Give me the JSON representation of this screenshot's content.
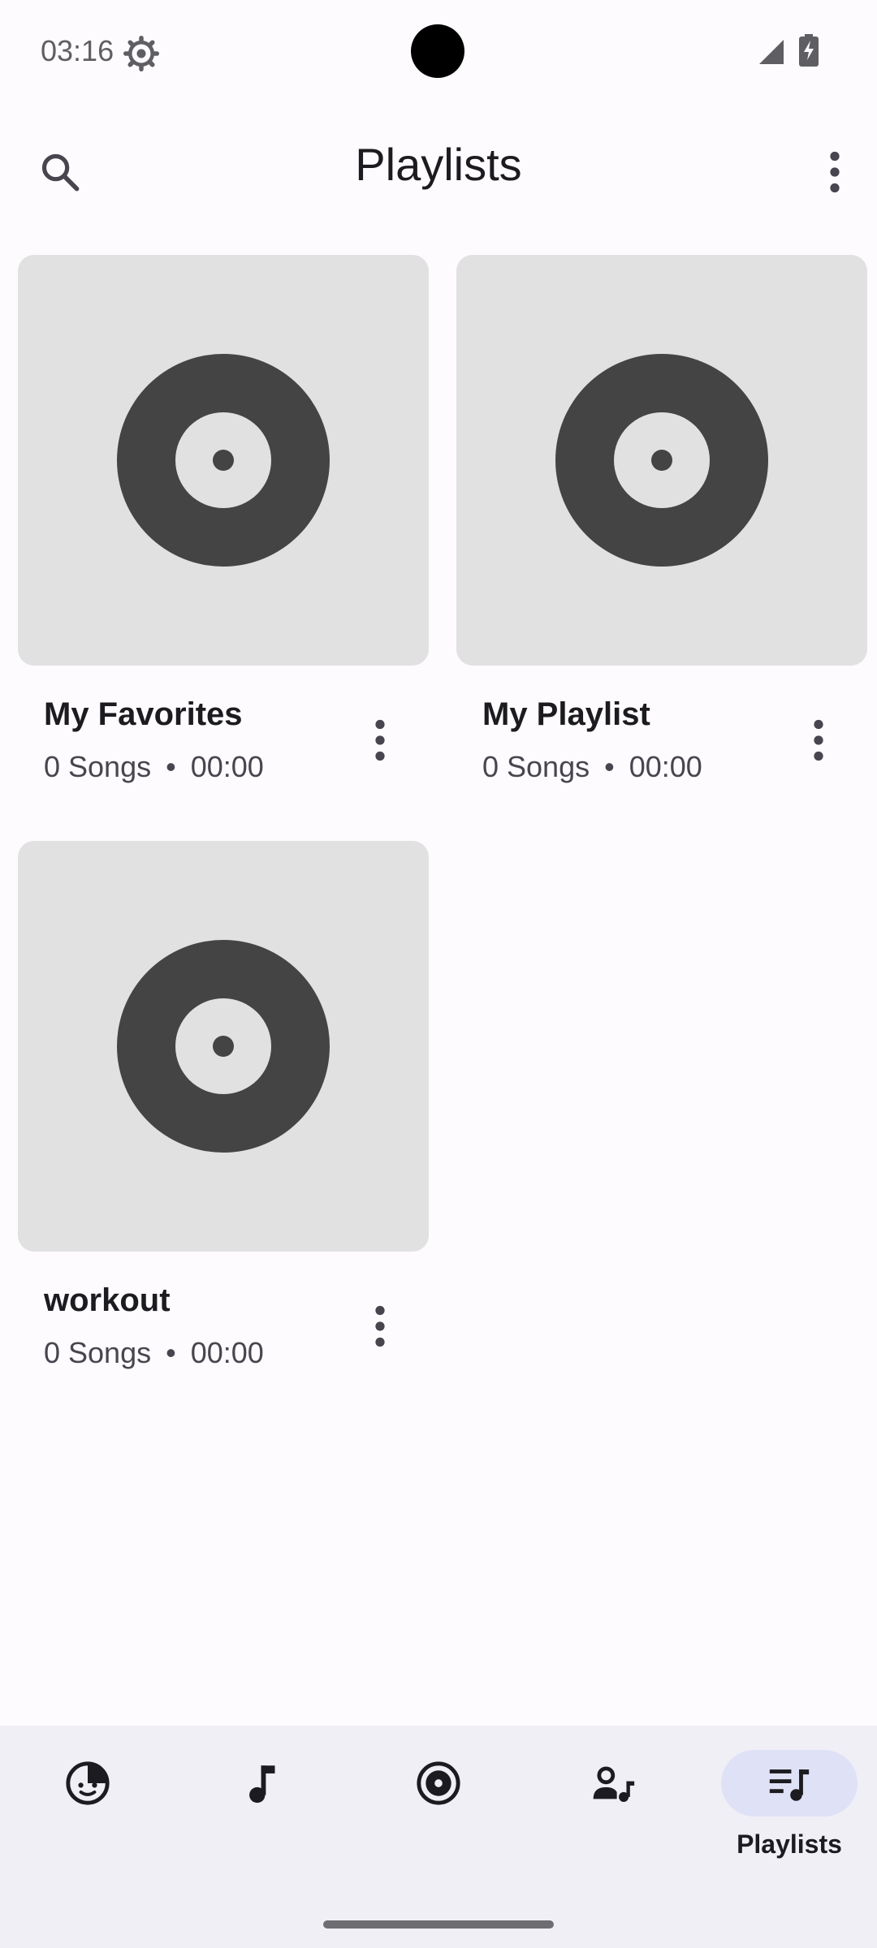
{
  "status_bar": {
    "time": "03:16",
    "icons": [
      "gear-icon",
      "signal-icon",
      "battery-charging-icon"
    ]
  },
  "top_bar": {
    "title": "Playlists",
    "icons": [
      "search-icon",
      "more-vertical-icon"
    ]
  },
  "playlists": [
    {
      "name": "My Favorites",
      "songs": "0 Songs",
      "separator": "•",
      "duration": "00:00"
    },
    {
      "name": "My Playlist",
      "songs": "0 Songs",
      "separator": "•",
      "duration": "00:00"
    },
    {
      "name": "workout",
      "songs": "0 Songs",
      "separator": "•",
      "duration": "00:00"
    }
  ],
  "bottom_nav": {
    "items": [
      {
        "icon": "for-you-face-icon",
        "label": ""
      },
      {
        "icon": "music-note-icon",
        "label": ""
      },
      {
        "icon": "album-icon",
        "label": ""
      },
      {
        "icon": "artist-icon",
        "label": ""
      },
      {
        "icon": "playlist-icon",
        "label": "Playlists",
        "active": true
      }
    ]
  },
  "colors": {
    "background": "#fdfbfe",
    "art_placeholder": "#e1e1e1",
    "disc": "#444444",
    "nav_background": "#f0eff6",
    "nav_active_pill": "#dfe1f6"
  }
}
